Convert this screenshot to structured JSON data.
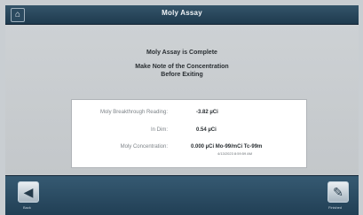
{
  "window": {
    "title": "Moly Assay",
    "home_icon": "home-icon"
  },
  "messages": {
    "complete": "Moly Assay is Complete",
    "note_line1": "Make Note of the Concentration",
    "note_line2": "Before Exiting"
  },
  "results": [
    {
      "label": "Moly Breakthrough Reading:",
      "value": "-3.82 µCi",
      "sub": ""
    },
    {
      "label": "In Dim:",
      "value": "0.54 µCi",
      "sub": ""
    },
    {
      "label": "Moly Concentration:",
      "value": "0.000 µCi Mo-99/mCi Tc-99m",
      "sub": "4/13/2023 8:59:59 AM"
    }
  ],
  "toolbar": {
    "back_label": "Back",
    "back_icon": "arrow-left-icon",
    "finish_label": "Finished",
    "finish_icon": "pen-icon"
  }
}
